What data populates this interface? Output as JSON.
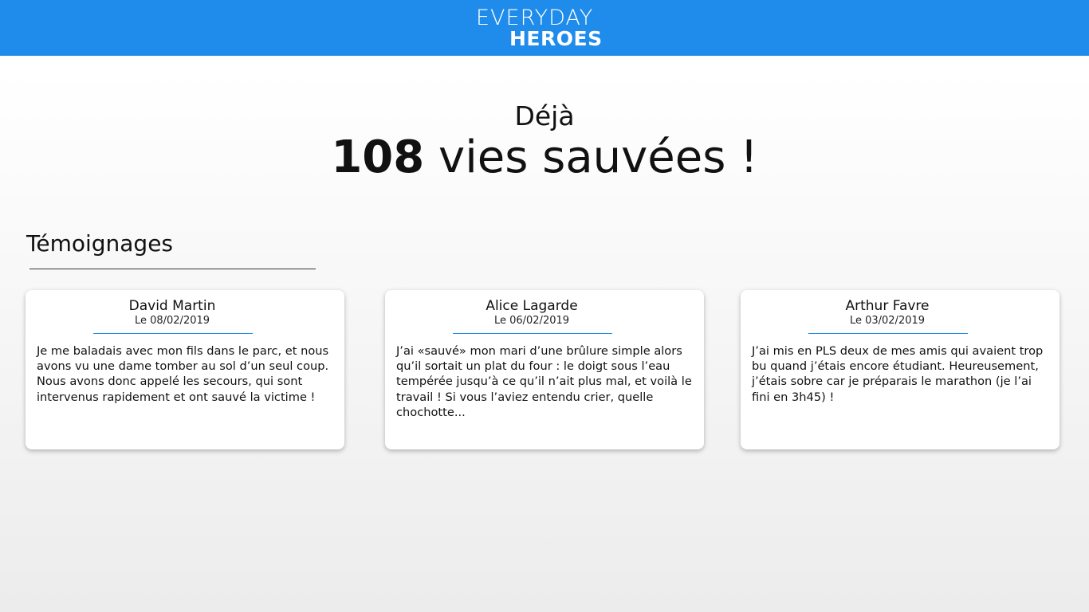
{
  "header": {
    "logo_line1": "EVERYDAY",
    "logo_line2": "HEROES",
    "background_color": "#1f8cec"
  },
  "hero": {
    "prefix": "Déjà",
    "count": "108",
    "suffix": " vies sauvées !"
  },
  "testimonials": {
    "title": "Témoignages",
    "items": [
      {
        "name": "David Martin",
        "date": "Le 08/02/2019",
        "text": "Je me baladais avec mon fils dans le parc, et nous avons vu une dame tomber au sol d’un seul coup. Nous avons donc appelé les secours, qui sont intervenus rapidement et ont sauvé la victime !"
      },
      {
        "name": "Alice Lagarde",
        "date": "Le 06/02/2019",
        "text": "J’ai «sauvé» mon mari d’une brûlure simple alors qu’il sortait un plat du four : le doigt sous l’eau tempérée jusqu’à ce qu’il n’ait plus mal, et voilà le travail ! Si vous l’aviez entendu crier, quelle chochotte..."
      },
      {
        "name": "Arthur Favre",
        "date": "Le 03/02/2019",
        "text": "J’ai mis en PLS deux de mes amis qui avaient trop bu quand j’étais encore étudiant. Heureusement, j’étais sobre car je préparais le marathon (je l’ai fini en 3h45) !"
      }
    ]
  }
}
